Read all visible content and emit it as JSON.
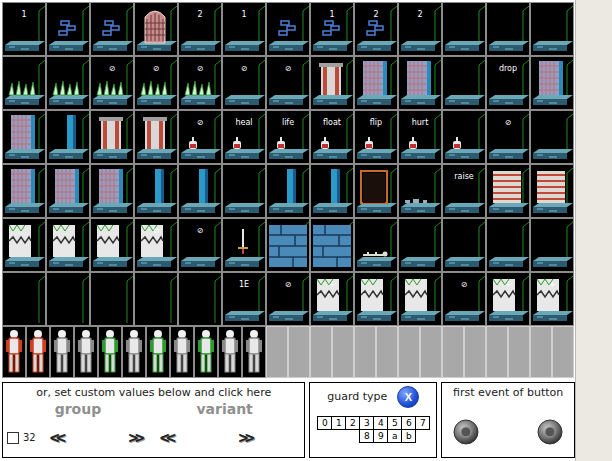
{
  "tiles": [
    [
      {
        "kind": "floor",
        "label": "1"
      },
      {
        "kind": "brick",
        "label": ""
      },
      {
        "kind": "brick",
        "label": ""
      },
      {
        "kind": "window",
        "label": ""
      },
      {
        "kind": "floor",
        "label": "2"
      },
      {
        "kind": "floor",
        "label": "1"
      },
      {
        "kind": "brick",
        "label": ""
      },
      {
        "kind": "brick",
        "label": "1"
      },
      {
        "kind": "brick",
        "label": "2"
      },
      {
        "kind": "floor",
        "label": "2"
      },
      {
        "kind": "floor",
        "label": ""
      },
      {
        "kind": "floor",
        "label": ""
      },
      {
        "kind": "floor",
        "label": ""
      }
    ],
    [
      {
        "kind": "spikes",
        "label": ""
      },
      {
        "kind": "spikes",
        "label": ""
      },
      {
        "kind": "spikes",
        "label": "⊘"
      },
      {
        "kind": "spikes",
        "label": "⊘"
      },
      {
        "kind": "spikes",
        "label": "⊘"
      },
      {
        "kind": "floor",
        "label": "⊘"
      },
      {
        "kind": "floor",
        "label": "⊘"
      },
      {
        "kind": "pillar",
        "label": ""
      },
      {
        "kind": "gate",
        "label": ""
      },
      {
        "kind": "gate",
        "label": ""
      },
      {
        "kind": "floor",
        "label": ""
      },
      {
        "kind": "floor",
        "label": "drop"
      },
      {
        "kind": "gate",
        "label": ""
      }
    ],
    [
      {
        "kind": "gate",
        "label": ""
      },
      {
        "kind": "column",
        "label": ""
      },
      {
        "kind": "pillar",
        "label": ""
      },
      {
        "kind": "pillar",
        "label": ""
      },
      {
        "kind": "potion",
        "label": "⊘"
      },
      {
        "kind": "potion",
        "label": "heal"
      },
      {
        "kind": "potion",
        "label": "life"
      },
      {
        "kind": "potion",
        "label": "float"
      },
      {
        "kind": "potion",
        "label": "flip"
      },
      {
        "kind": "potion",
        "label": "hurt"
      },
      {
        "kind": "potion",
        "label": ""
      },
      {
        "kind": "floor",
        "label": "⊘"
      },
      {
        "kind": "floor",
        "label": ""
      }
    ],
    [
      {
        "kind": "gate",
        "label": ""
      },
      {
        "kind": "gate",
        "label": ""
      },
      {
        "kind": "gate",
        "label": ""
      },
      {
        "kind": "column",
        "label": ""
      },
      {
        "kind": "column",
        "label": ""
      },
      {
        "kind": "floor",
        "label": ""
      },
      {
        "kind": "column",
        "label": ""
      },
      {
        "kind": "column",
        "label": ""
      },
      {
        "kind": "door",
        "label": ""
      },
      {
        "kind": "rubble",
        "label": ""
      },
      {
        "kind": "floor",
        "label": "raise"
      },
      {
        "kind": "exit",
        "label": ""
      },
      {
        "kind": "exit",
        "label": ""
      }
    ],
    [
      {
        "kind": "chomper",
        "label": ""
      },
      {
        "kind": "chomper",
        "label": ""
      },
      {
        "kind": "chomper",
        "label": ""
      },
      {
        "kind": "chomper",
        "label": "⊘"
      },
      {
        "kind": "floor",
        "label": "⊘"
      },
      {
        "kind": "sword",
        "label": ""
      },
      {
        "kind": "wall",
        "label": ""
      },
      {
        "kind": "wall",
        "label": ""
      },
      {
        "kind": "skeleton",
        "label": ""
      },
      {
        "kind": "floor",
        "label": ""
      },
      {
        "kind": "floor",
        "label": ""
      },
      {
        "kind": "floor",
        "label": ""
      },
      {
        "kind": "floor",
        "label": ""
      }
    ],
    [
      {
        "kind": "space",
        "label": ""
      },
      {
        "kind": "space",
        "label": ""
      },
      {
        "kind": "space",
        "label": ""
      },
      {
        "kind": "space",
        "label": ""
      },
      {
        "kind": "space",
        "label": ""
      },
      {
        "kind": "floor",
        "label": "1E"
      },
      {
        "kind": "floor",
        "label": "⊘"
      },
      {
        "kind": "chomper",
        "label": "+"
      },
      {
        "kind": "chomper",
        "label": ""
      },
      {
        "kind": "chomper",
        "label": ""
      },
      {
        "kind": "floor",
        "label": "⊘"
      },
      {
        "kind": "chomper",
        "label": "+"
      },
      {
        "kind": "chomper",
        "label": "+"
      }
    ]
  ],
  "sprites": [
    {
      "kind": "guard",
      "color": "#d04020"
    },
    {
      "kind": "guard",
      "color": "#d04020"
    },
    {
      "kind": "guard",
      "color": "#8a8a8a"
    },
    {
      "kind": "guard",
      "color": "#8a8a8a"
    },
    {
      "kind": "guard",
      "color": "#2f9a2f"
    },
    {
      "kind": "guard",
      "color": "#8a8a8a"
    },
    {
      "kind": "guard",
      "color": "#2f9a2f"
    },
    {
      "kind": "guard",
      "color": "#8a8a8a"
    },
    {
      "kind": "guard",
      "color": "#2f9a2f"
    },
    {
      "kind": "guard",
      "color": "#8a8a8a"
    },
    {
      "kind": "guard",
      "color": "#8a8a8a"
    },
    {
      "kind": "blank"
    },
    {
      "kind": "blank"
    },
    {
      "kind": "blank"
    },
    {
      "kind": "blank"
    },
    {
      "kind": "blank"
    },
    {
      "kind": "blank"
    },
    {
      "kind": "blank"
    },
    {
      "kind": "blank"
    },
    {
      "kind": "blank"
    },
    {
      "kind": "blank"
    },
    {
      "kind": "blank"
    },
    {
      "kind": "blank"
    },
    {
      "kind": "blank"
    },
    {
      "kind": "blank"
    }
  ],
  "custom": {
    "title": "or, set custom values below and click here",
    "group": "group",
    "variant": "variant",
    "checkbox": {
      "label": "32",
      "checked": false
    },
    "group_prev": "<<",
    "group_next": ">>",
    "variant_prev": "<<",
    "variant_next": ">>"
  },
  "guard": {
    "title": "guard type",
    "clear": "X",
    "types": [
      {
        "label": "0",
        "selected": false
      },
      {
        "label": "1",
        "selected": false
      },
      {
        "label": "2",
        "selected": false
      },
      {
        "label": "3",
        "selected": false
      },
      {
        "label": "4",
        "selected": false
      },
      {
        "label": "5",
        "selected": false
      },
      {
        "label": "6",
        "selected": false
      },
      {
        "label": "7",
        "selected": false
      },
      {
        "label": "8",
        "selected": false
      },
      {
        "label": "9",
        "selected": false
      },
      {
        "label": "a",
        "selected": false
      },
      {
        "label": "b",
        "selected": false
      }
    ]
  },
  "event": {
    "title": "first event of button"
  }
}
